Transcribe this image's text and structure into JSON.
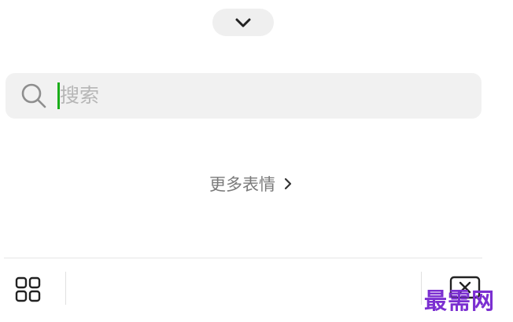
{
  "panel": {
    "collapse_icon": "chevron-down-icon"
  },
  "search": {
    "icon": "search-icon",
    "placeholder": "搜索"
  },
  "more_stickers": {
    "label": "更多表情",
    "icon": "chevron-right-icon"
  },
  "toolbar": {
    "left_icon": "grid-icon",
    "right_icon": "delete-icon"
  },
  "watermark": {
    "text": "最需网"
  },
  "colors": {
    "accent_caret": "#1aad19",
    "watermark": "#7b2fd1"
  }
}
